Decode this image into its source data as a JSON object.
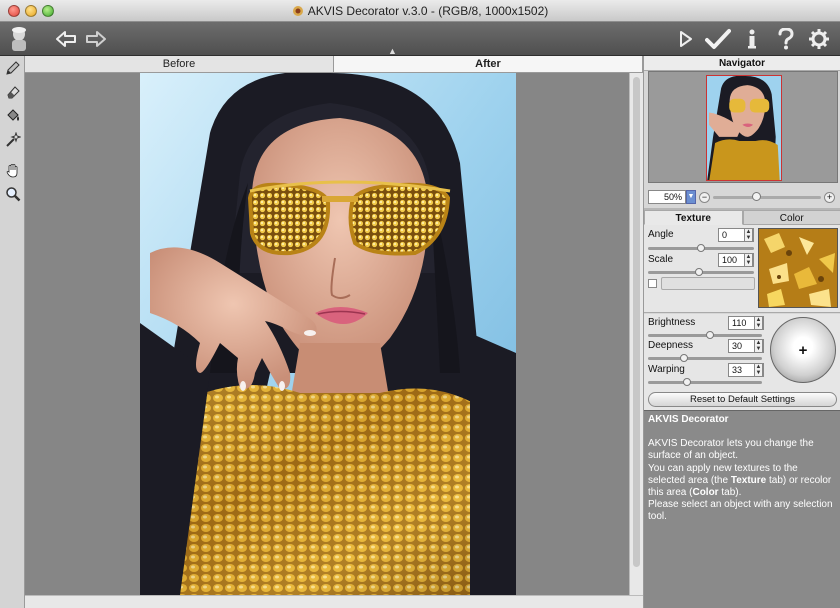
{
  "window": {
    "title": "AKVIS Decorator v.3.0 -  (RGB/8, 1000x1502)"
  },
  "toolbar": {
    "left_icons": [
      "akvis-logo-icon",
      "undo-arrow-icon",
      "redo-arrow-icon"
    ],
    "right_icons": [
      "run-play-icon",
      "apply-check-icon",
      "info-icon",
      "help-question-icon",
      "settings-gear-icon"
    ]
  },
  "left_tools": [
    "selection-pencil-icon",
    "eraser-icon",
    "paint-bucket-icon",
    "magic-wand-icon",
    "hand-icon",
    "zoom-magnifier-icon"
  ],
  "tabs": {
    "before": "Before",
    "after": "After",
    "active": "after"
  },
  "navigator": {
    "title": "Navigator",
    "zoom_value": "50%",
    "zoom_minus": "−",
    "zoom_plus": "+",
    "zoom_slider_fraction": 0.36
  },
  "settings_tabs": {
    "texture": "Texture",
    "color": "Color",
    "active": "texture"
  },
  "texture": {
    "angle_label": "Angle",
    "angle_value": "0",
    "angle_fraction": 0.5,
    "scale_label": "Scale",
    "scale_value": "100",
    "scale_fraction": 0.48
  },
  "adjust": {
    "brightness_label": "Brightness",
    "brightness_value": "110",
    "brightness_fraction": 0.55,
    "deepness_label": "Deepness",
    "deepness_value": "30",
    "deepness_fraction": 0.3,
    "warping_label": "Warping",
    "warping_value": "33",
    "warping_fraction": 0.33,
    "ball_symbol": "+",
    "reset_label": "Reset to Default Settings"
  },
  "help": {
    "title": "AKVIS Decorator",
    "p1": "AKVIS Decorator lets you change the surface of an object.",
    "p2_a": "You can apply new textures to the selected area (the ",
    "p2_b": "Texture",
    "p2_c": " tab) or recolor this area (",
    "p2_d": "Color",
    "p2_e": " tab).",
    "p3": "Please select an object with any selection tool."
  },
  "colors": {
    "gold": "#c9961c",
    "hair": "#1b1b24",
    "sky": "#a9d8f1",
    "skin": "#e2b49c",
    "lips": "#d9637d"
  }
}
